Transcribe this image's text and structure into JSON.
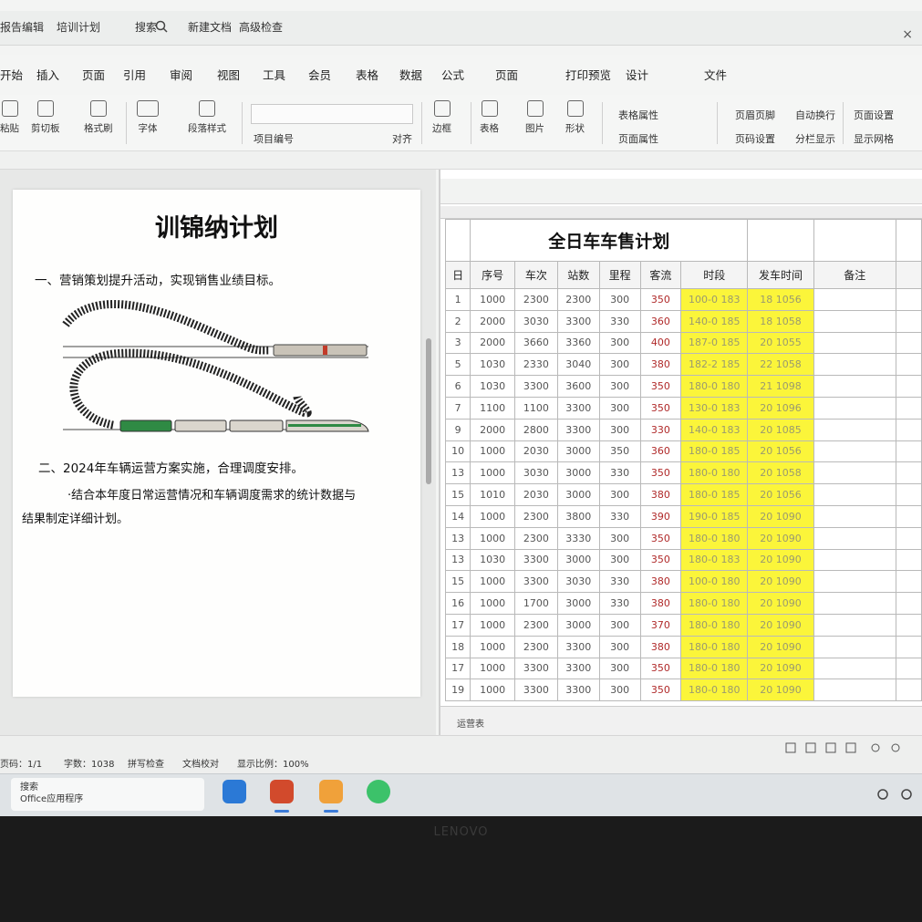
{
  "window": {
    "tabs": [
      "报告编辑",
      "培训计划",
      "搜索",
      "新建文档",
      "高级检查"
    ],
    "close_label": "×"
  },
  "menu": [
    "开始",
    "插入",
    "页面",
    "引用",
    "审阅",
    "视图",
    "工具",
    "会员",
    "表格",
    "数据",
    "公式",
    "页面",
    "打印预览",
    "设计",
    "文件"
  ],
  "toolbar": {
    "buttons": [
      "粘贴",
      "剪切板",
      "格式刷",
      "字体",
      "段落样式",
      "项目编号",
      "对齐",
      "边框",
      "表格",
      "图片",
      "形状"
    ],
    "right_labels": [
      "表格属性",
      "页面属性",
      "页眉页脚",
      "页码设置",
      "自动换行",
      "分栏显示",
      "页面设置",
      "显示网格"
    ]
  },
  "document": {
    "title": "训锦纳计划",
    "para1": "一、营销策划提升活动，实现销售业绩目标。",
    "para2": "二、2024年车辆运营方案实施，合理调度安排。",
    "para3": "·结合本年度日常运营情况和车辆调度需求的统计数据与",
    "para4": "结果制定详细计划。"
  },
  "sheet": {
    "title": "全日车车售计划",
    "headers": [
      "日",
      "序号",
      "车次",
      "站数",
      "里程",
      "客流",
      "时段",
      "发车时间",
      "备注"
    ],
    "rows": [
      [
        "1",
        "1000",
        "2300",
        "2300",
        "300",
        "350",
        "100-0 183",
        "18 1056"
      ],
      [
        "2",
        "2000",
        "3030",
        "3300",
        "330",
        "360",
        "140-0 185",
        "18 1058"
      ],
      [
        "3",
        "2000",
        "3660",
        "3360",
        "300",
        "400",
        "187-0 185",
        "20 1055"
      ],
      [
        "5",
        "1030",
        "2330",
        "3040",
        "300",
        "380",
        "182-2 185",
        "22 1058"
      ],
      [
        "6",
        "1030",
        "3300",
        "3600",
        "300",
        "350",
        "180-0 180",
        "21 1098"
      ],
      [
        "7",
        "1100",
        "1100",
        "3300",
        "300",
        "350",
        "130-0 183",
        "20 1096"
      ],
      [
        "9",
        "2000",
        "2800",
        "3300",
        "300",
        "330",
        "140-0 183",
        "20 1085"
      ],
      [
        "10",
        "1000",
        "2030",
        "3000",
        "350",
        "360",
        "180-0 185",
        "20 1056"
      ],
      [
        "13",
        "1000",
        "3030",
        "3000",
        "330",
        "350",
        "180-0 180",
        "20 1058"
      ],
      [
        "15",
        "1010",
        "2030",
        "3000",
        "300",
        "380",
        "180-0 185",
        "20 1056"
      ],
      [
        "14",
        "1000",
        "2300",
        "3800",
        "330",
        "390",
        "190-0 185",
        "20 1090"
      ],
      [
        "13",
        "1000",
        "2300",
        "3330",
        "300",
        "350",
        "180-0 180",
        "20 1090"
      ],
      [
        "13",
        "1030",
        "3300",
        "3000",
        "300",
        "350",
        "180-0 183",
        "20 1090"
      ],
      [
        "15",
        "1000",
        "3300",
        "3030",
        "330",
        "380",
        "100-0 180",
        "20 1090"
      ],
      [
        "16",
        "1000",
        "1700",
        "3000",
        "330",
        "380",
        "180-0 180",
        "20 1090"
      ],
      [
        "17",
        "1000",
        "2300",
        "3000",
        "300",
        "370",
        "180-0 180",
        "20 1090"
      ],
      [
        "18",
        "1000",
        "2300",
        "3300",
        "300",
        "380",
        "180-0 180",
        "20 1090"
      ],
      [
        "17",
        "1000",
        "3300",
        "3300",
        "300",
        "350",
        "180-0 180",
        "20 1090"
      ],
      [
        "19",
        "1000",
        "3300",
        "3300",
        "300",
        "350",
        "180-0 180",
        "20 1090"
      ]
    ],
    "sheet_tab": "运营表"
  },
  "status": {
    "items": [
      "页码：1/1",
      "字数：1038",
      "拼写检查",
      "文档校对",
      "显示比例：100%"
    ]
  },
  "taskbar": {
    "search_line1": "搜索",
    "search_line2": "Office应用程序"
  },
  "bezel_brand": "LENOVO"
}
